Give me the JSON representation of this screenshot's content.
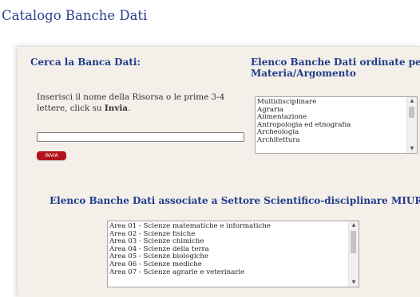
{
  "page": {
    "title": "Catalogo Banche Dati"
  },
  "search": {
    "heading": "Cerca la Banca Dati:",
    "instruction_prefix": "Inserisci il nome della Risorsa o le prime 3-4 lettere, click su ",
    "instruction_bold": "Invia",
    "instruction_suffix": ".",
    "input_value": "",
    "submit_label": "INVIA"
  },
  "materia": {
    "heading": "Elenco Banche Dati ordinate per Materia/Argomento",
    "options": [
      "Multidisciplinare",
      "Agraria",
      "Alimentazione",
      "Antropologia ed etnografia",
      "Archeologia",
      "Architettura"
    ]
  },
  "ssd": {
    "heading": "Elenco Banche Dati associate a Settore Scientifico-disciplinare MIUR",
    "options": [
      "Area 01 - Scienze matematiche e informatiche",
      "Area 02 - Scienze fisiche",
      "Area 03 - Scienze chimiche",
      "Area 04 - Scienze della terra",
      "Area 05 - Scienze biologiche",
      "Area 06 - Scienze mediche",
      "Area 07 - Scienze agrarie e veterinarie"
    ]
  },
  "colors": {
    "heading": "#1f3c8c",
    "button": "#b3141b",
    "panel": "#f4efe9"
  },
  "icons": {
    "scroll_up": "triangle-up",
    "scroll_down": "triangle-down"
  }
}
